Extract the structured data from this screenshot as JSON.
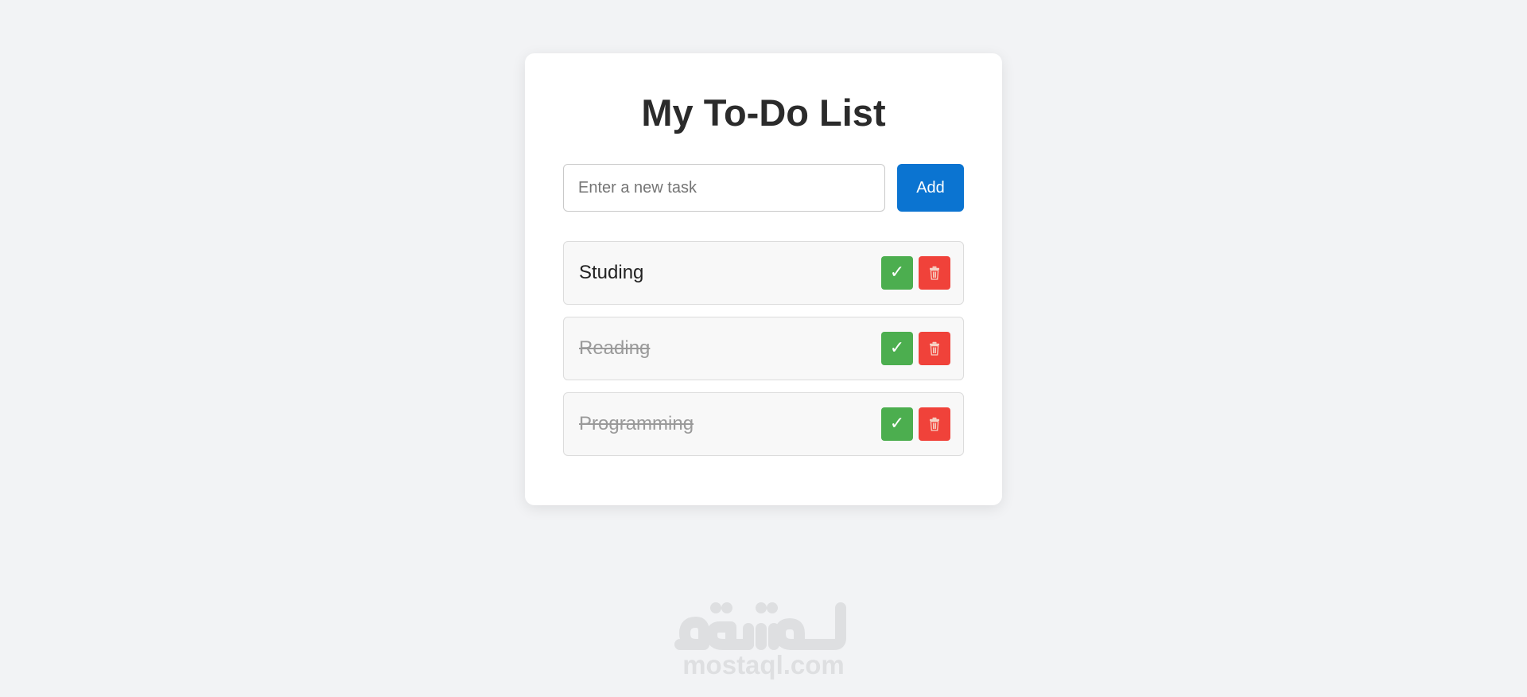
{
  "app": {
    "title": "My To-Do List"
  },
  "new_task": {
    "value": "",
    "placeholder": "Enter a new task",
    "add_label": "Add"
  },
  "tasks": [
    {
      "text": "Studing",
      "completed": false
    },
    {
      "text": "Reading",
      "completed": true
    },
    {
      "text": "Programming",
      "completed": true
    }
  ],
  "icons": {
    "complete": "check-icon",
    "delete": "trash-icon"
  },
  "colors": {
    "page_background": "#f2f3f5",
    "add_button": "#0b74d1",
    "complete_button": "#4cae4f",
    "delete_button": "#f0423a",
    "completed_text": "#9a9a9a"
  },
  "watermark": {
    "arabic": "مستقل",
    "latin": "mostaql.com"
  }
}
